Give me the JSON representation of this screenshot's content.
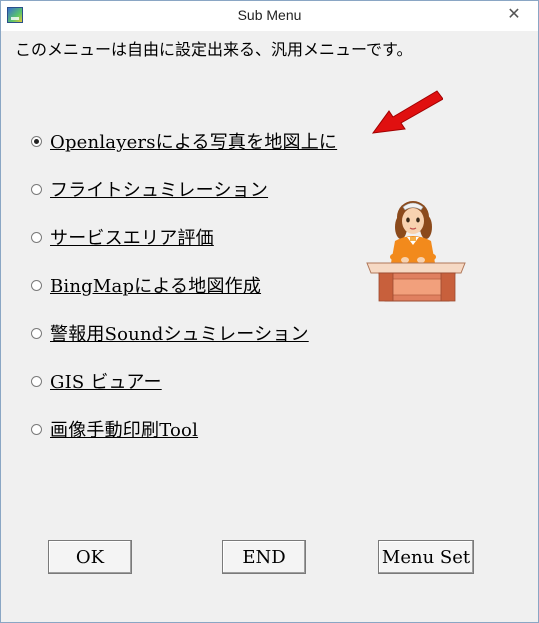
{
  "window": {
    "title": "Sub Menu",
    "close_symbol": "✕"
  },
  "intro": {
    "text": "このメニューは自由に設定出来る、汎用メニューです。"
  },
  "menu": {
    "items": [
      {
        "label": "Openlayersによる写真を地図上に",
        "selected": true
      },
      {
        "label": "フライトシュミレーション",
        "selected": false
      },
      {
        "label": "サービスエリア評価",
        "selected": false
      },
      {
        "label": "BingMapによる地図作成",
        "selected": false
      },
      {
        "label": "警報用Soundシュミレーション",
        "selected": false
      },
      {
        "label": "GIS ビュアー",
        "selected": false
      },
      {
        "label": "画像手動印刷Tool",
        "selected": false
      }
    ]
  },
  "buttons": {
    "ok": "OK",
    "end": "END",
    "menu_set": "Menu Set"
  },
  "icons": {
    "app": "app-icon",
    "arrow": "red-arrow-icon",
    "figure": "receptionist-desk-icon"
  },
  "colors": {
    "arrow": "#e01010",
    "background": "#f0f0f0"
  }
}
